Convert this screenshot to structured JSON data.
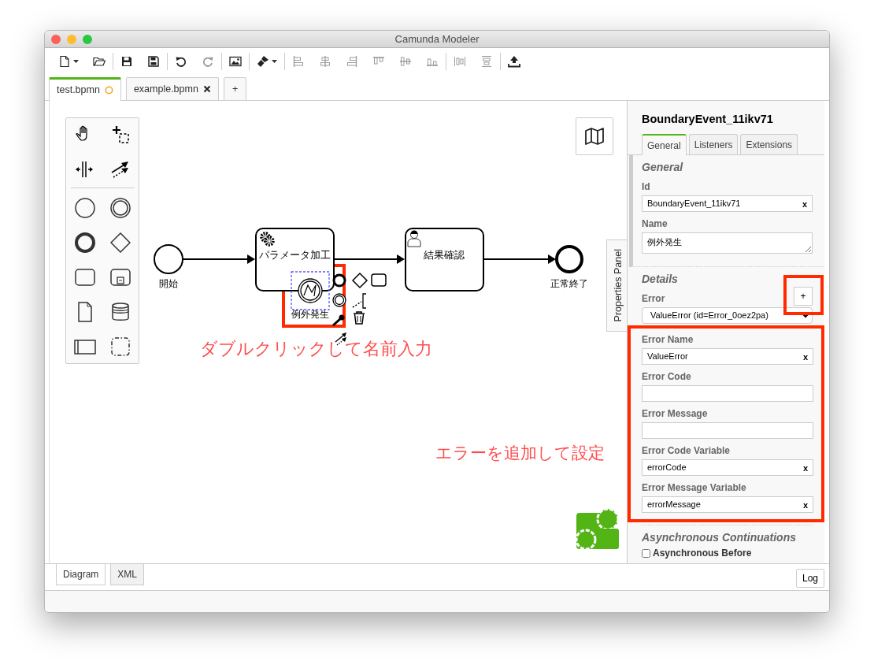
{
  "window": {
    "title": "Camunda Modeler"
  },
  "toolbar": {
    "groups": [
      [
        {
          "disabled": false,
          "menu": true
        },
        {
          "disabled": false,
          "menu": false
        }
      ],
      [
        {
          "disabled": false,
          "menu": false
        },
        {
          "disabled": false,
          "menu": false
        }
      ],
      [
        {
          "disabled": false,
          "menu": false
        },
        {
          "disabled": true,
          "menu": false
        }
      ],
      [
        {
          "disabled": false,
          "menu": false
        }
      ],
      [
        {
          "disabled": false,
          "menu": true
        }
      ],
      [
        {
          "disabled": true,
          "menu": false
        },
        {
          "disabled": true,
          "menu": false
        },
        {
          "disabled": true,
          "menu": false
        },
        {
          "disabled": true,
          "menu": false
        },
        {
          "disabled": true,
          "menu": false
        },
        {
          "disabled": true,
          "menu": false
        }
      ],
      [
        {
          "disabled": true,
          "menu": false
        },
        {
          "disabled": true,
          "menu": false
        }
      ],
      [
        {
          "disabled": false,
          "menu": false
        }
      ]
    ]
  },
  "file_tabs": [
    {
      "label": "test.bpmn",
      "selected": true,
      "unsaved": true
    },
    {
      "label": "example.bpmn",
      "selected": false,
      "unsaved": false
    }
  ],
  "new_tab_label": "+",
  "diagram": {
    "nodes": [
      {
        "kind": "start_event",
        "label": "開始",
        "selected": false
      },
      {
        "kind": "service_task",
        "label": "パラメータ加工",
        "selected": false
      },
      {
        "kind": "user_task",
        "label": "結果確認",
        "selected": false
      },
      {
        "kind": "end_event",
        "label": "正常終了",
        "selected": false
      },
      {
        "kind": "error_boundary_event",
        "label": "例外発生",
        "selected": true
      }
    ]
  },
  "annotations": [
    {
      "text": "ダブルクリックして名前入力"
    },
    {
      "text": "エラーを追加して設定"
    }
  ],
  "side_tab": "Properties Panel",
  "properties": {
    "title": "BoundaryEvent_11ikv71",
    "tabs": [
      {
        "label": "General",
        "selected": true
      },
      {
        "label": "Listeners",
        "selected": false
      },
      {
        "label": "Extensions",
        "selected": false
      }
    ],
    "groups": [
      {
        "title": "General",
        "fields": [
          {
            "kind": "text",
            "label": "Id",
            "value": "BoundaryEvent_11ikv71",
            "clear_label": "x"
          },
          {
            "kind": "textarea",
            "label": "Name",
            "value": "例外発生"
          }
        ]
      },
      {
        "title": "Details",
        "fields": [
          {
            "kind": "select",
            "label": "Error",
            "value": "ValueError (id=Error_0oez2pa)",
            "add_label": "+"
          }
        ],
        "highlighted_fields": [
          {
            "kind": "text",
            "label": "Error Name",
            "value": "ValueError",
            "clear_label": "x"
          },
          {
            "kind": "text",
            "label": "Error Code"
          },
          {
            "kind": "text",
            "label": "Error Message"
          },
          {
            "kind": "text",
            "label": "Error Code Variable",
            "value": "errorCode",
            "clear_label": "x"
          },
          {
            "kind": "text",
            "label": "Error Message Variable",
            "value": "errorMessage",
            "clear_label": "x"
          }
        ]
      },
      {
        "title": "Asynchronous Continuations",
        "fields": [
          {
            "kind": "checkbox",
            "label": "Asynchronous Before",
            "checked": false
          }
        ]
      }
    ]
  },
  "view_tabs": [
    {
      "label": "Diagram",
      "selected": true
    },
    {
      "label": "XML",
      "selected": false
    }
  ],
  "log_button": "Log"
}
